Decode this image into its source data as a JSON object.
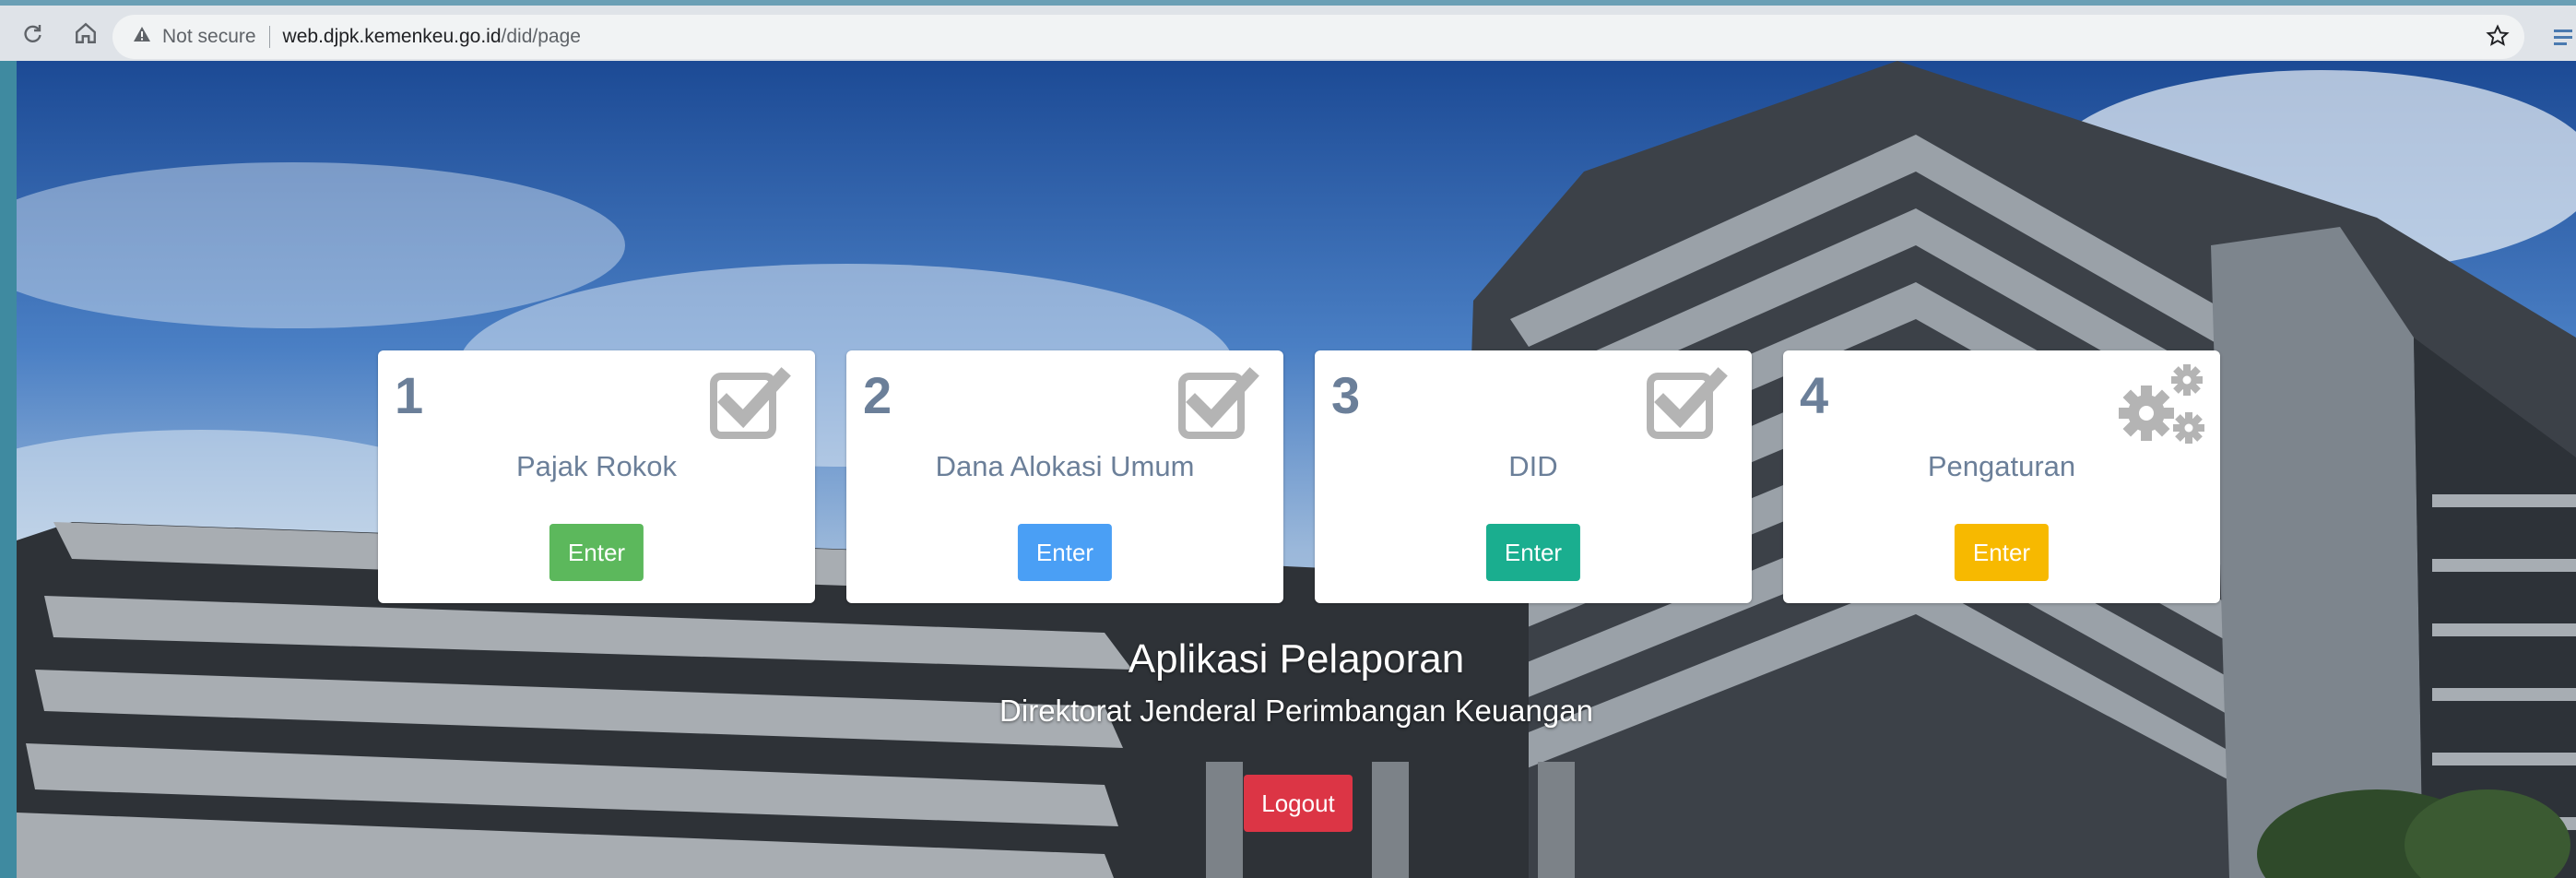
{
  "browser": {
    "security_label": "Not secure",
    "url_host": "web.djpk.kemenkeu.go.id",
    "url_path": "/did/page"
  },
  "cards": [
    {
      "number": "1",
      "title": "Pajak Rokok",
      "button": "Enter",
      "button_color": "#5cb85c",
      "icon": "checkbox-icon"
    },
    {
      "number": "2",
      "title": "Dana Alokasi Umum",
      "button": "Enter",
      "button_color": "#4a9ff5",
      "icon": "checkbox-icon"
    },
    {
      "number": "3",
      "title": "DID",
      "button": "Enter",
      "button_color": "#1aae8f",
      "icon": "checkbox-icon"
    },
    {
      "number": "4",
      "title": "Pengaturan",
      "button": "Enter",
      "button_color": "#f7b900",
      "icon": "gears-icon"
    }
  ],
  "app": {
    "title": "Aplikasi Pelaporan",
    "subtitle": "Direktorat Jenderal Perimbangan Keuangan",
    "logout_label": "Logout",
    "logout_color": "#dc3545"
  }
}
